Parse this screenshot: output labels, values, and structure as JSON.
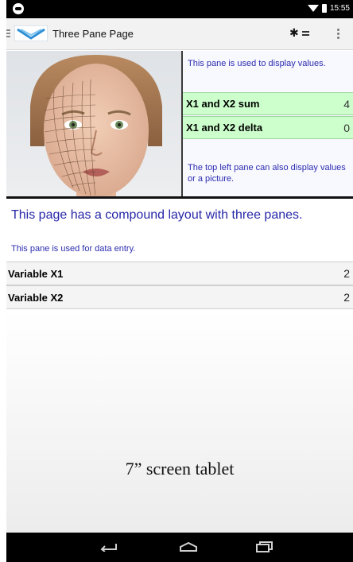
{
  "status_bar": {
    "time": "15:55"
  },
  "action_bar": {
    "title": "Three Pane Page",
    "icons": [
      "app-logo",
      "bluetooth-icon",
      "list-icon",
      "overflow-menu-icon"
    ]
  },
  "value_pane": {
    "intro": "This pane is used to display values.",
    "rows": [
      {
        "label": "X1 and X2 sum",
        "value": "4"
      },
      {
        "label": "X1 and X2 delta",
        "value": "0"
      }
    ],
    "footer": "The top left pane can also display values or a picture."
  },
  "main_pane": {
    "heading": "This page has a compound layout with three panes.",
    "note": "This pane is used for data entry.",
    "entries": [
      {
        "label": "Variable X1",
        "value": "2"
      },
      {
        "label": "Variable X2",
        "value": "2"
      }
    ]
  },
  "caption": "7” screen tablet",
  "colors": {
    "value_row_bg": "#ccffcc",
    "blue_text": "#2c2cb0",
    "nav_bar": "#000000"
  },
  "nav_bar": {
    "icons": [
      "back-icon",
      "home-icon",
      "recents-icon"
    ]
  }
}
